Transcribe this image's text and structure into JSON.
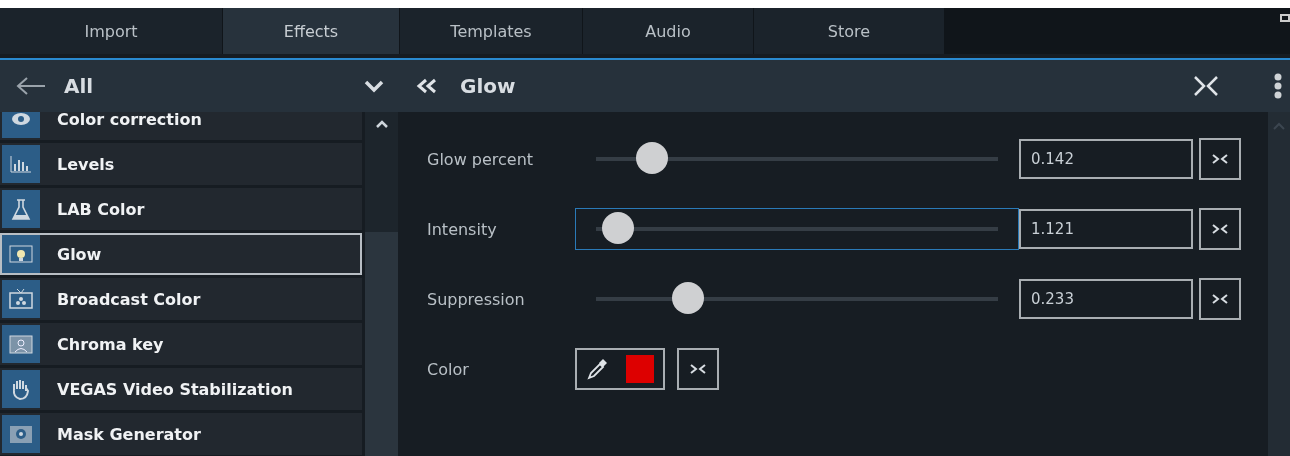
{
  "tabs": [
    {
      "label": "Import",
      "selected": false
    },
    {
      "label": "Effects",
      "selected": true
    },
    {
      "label": "Templates",
      "selected": false
    },
    {
      "label": "Audio",
      "selected": false
    },
    {
      "label": "Store",
      "selected": false
    }
  ],
  "browser": {
    "category": "All",
    "items": [
      {
        "label": "Color correction",
        "selected": false
      },
      {
        "label": "Levels",
        "selected": false
      },
      {
        "label": "LAB Color",
        "selected": false
      },
      {
        "label": "Glow",
        "selected": true
      },
      {
        "label": "Broadcast Color",
        "selected": false
      },
      {
        "label": "Chroma key",
        "selected": false
      },
      {
        "label": "VEGAS Video Stabilization",
        "selected": false
      },
      {
        "label": "Mask Generator",
        "selected": false
      }
    ]
  },
  "panel": {
    "title": "Glow",
    "params": [
      {
        "kind": "slider",
        "label": "Glow percent",
        "level": 0.14,
        "value": "0.142",
        "focused": false
      },
      {
        "kind": "slider",
        "label": "Intensity",
        "level": 0.055,
        "value": "1.121",
        "focused": true
      },
      {
        "kind": "slider",
        "label": "Suppression",
        "level": 0.23,
        "value": "0.233",
        "focused": false
      },
      {
        "kind": "color",
        "label": "Color",
        "color": "#dd0000"
      }
    ]
  }
}
